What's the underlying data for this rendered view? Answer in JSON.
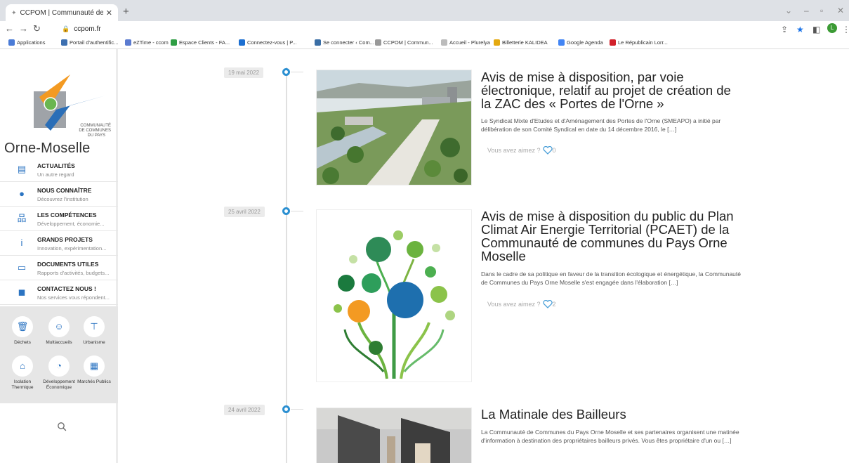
{
  "browser": {
    "tab_title": "CCPOM | Communauté de Com",
    "url": "ccpom.fr",
    "bookmarks": [
      {
        "label": "Applications",
        "color": "#4a7bd6"
      },
      {
        "label": "Portail d'authentific...",
        "color": "#3c6fb0"
      },
      {
        "label": "eZTime - ccom",
        "color": "#5b7bd0"
      },
      {
        "label": "Espace Clients - FA...",
        "color": "#2f9e44"
      },
      {
        "label": "Connectez-vous | P...",
        "color": "#1c6fd1"
      },
      {
        "label": "Se connecter ‹ Com...",
        "color": "#3a6ea5"
      },
      {
        "label": "CCPOM | Commun...",
        "color": "#999999"
      },
      {
        "label": "Accueil - Plurelya",
        "color": "#bbbbbb"
      },
      {
        "label": "Billetterie KALIDEA",
        "color": "#e4a90f"
      },
      {
        "label": "Google Agenda",
        "color": "#4285f4"
      },
      {
        "label": "Le Républicain Lorr...",
        "color": "#d1202a"
      }
    ]
  },
  "sidebar": {
    "logo_lines": [
      "COMMUNAUTÉ",
      "DE COMMUNES",
      "DU PAYS"
    ],
    "logo_name": "Orne-Moselle",
    "menu": [
      {
        "title": "ACTUALITÉS",
        "subtitle": "Un autre regard",
        "icon": "newspaper-icon",
        "glyph": "▤"
      },
      {
        "title": "NOUS CONNAÎTRE",
        "subtitle": "Découvrez l'institution",
        "icon": "speech-bubble-icon",
        "glyph": "●"
      },
      {
        "title": "LES COMPÉTENCES",
        "subtitle": "Développement, économie...",
        "icon": "org-chart-icon",
        "glyph": "品"
      },
      {
        "title": "GRANDS PROJETS",
        "subtitle": "Innovation, expérimentation...",
        "icon": "info-icon",
        "glyph": "i"
      },
      {
        "title": "DOCUMENTS UTILES",
        "subtitle": "Rapports d'activités, budgets...",
        "icon": "archive-icon",
        "glyph": "▭"
      },
      {
        "title": "CONTACTEZ NOUS !",
        "subtitle": "Nos services vous répondent...",
        "icon": "chat-icon",
        "glyph": "◼"
      }
    ],
    "quick_links": [
      {
        "label": "Déchets",
        "icon": "trash-icon",
        "glyph": "🗑"
      },
      {
        "label": "Multiaccueils",
        "icon": "baby-icon",
        "glyph": "☺"
      },
      {
        "label": "Urbanisme",
        "icon": "signpost-icon",
        "glyph": "⊤"
      },
      {
        "label": "Isolation Thermique",
        "icon": "house-icon",
        "glyph": "⌂"
      },
      {
        "label": "Développement Économique",
        "icon": "gauge-icon",
        "glyph": "◔"
      },
      {
        "label": "Marchés Publics",
        "icon": "calendar-icon",
        "glyph": "▦"
      }
    ]
  },
  "posts": [
    {
      "date": "19 mai 2022",
      "title": "Avis de mise à disposition, par voie électronique, relatif au projet de création de la ZAC des « Portes de l'Orne »",
      "excerpt": "Le Syndicat Mixte d'Etudes et d'Aménagement des Portes de l'Orne (SMEAPO) a initié par délibération de son Comité Syndical en date du 14 décembre 2016, le […]",
      "like_label": "Vous avez aimez ?",
      "likes": "0"
    },
    {
      "date": "25 avril 2022",
      "title": "Avis de mise à disposition du public du Plan Climat Air Energie Territorial (PCAET) de la Communauté de communes du Pays Orne Moselle",
      "excerpt": "Dans le cadre de sa politique en faveur de la transition écologique et énergétique, la Communauté de Communes du Pays Orne Moselle s'est engagée dans l'élaboration […]",
      "like_label": "Vous avez aimez ?",
      "likes": "2"
    },
    {
      "date": "24 avril 2022",
      "title": "La Matinale des Bailleurs",
      "excerpt": "La Communauté de Communes du Pays Orne Moselle et ses partenaires organisent une matinée d'information à destination des propriétaires bailleurs privés. Vous êtes propriétaire d'un ou […]"
    }
  ],
  "colors": {
    "accent": "#2b8fd1",
    "menu_icon": "#2b74c2"
  }
}
